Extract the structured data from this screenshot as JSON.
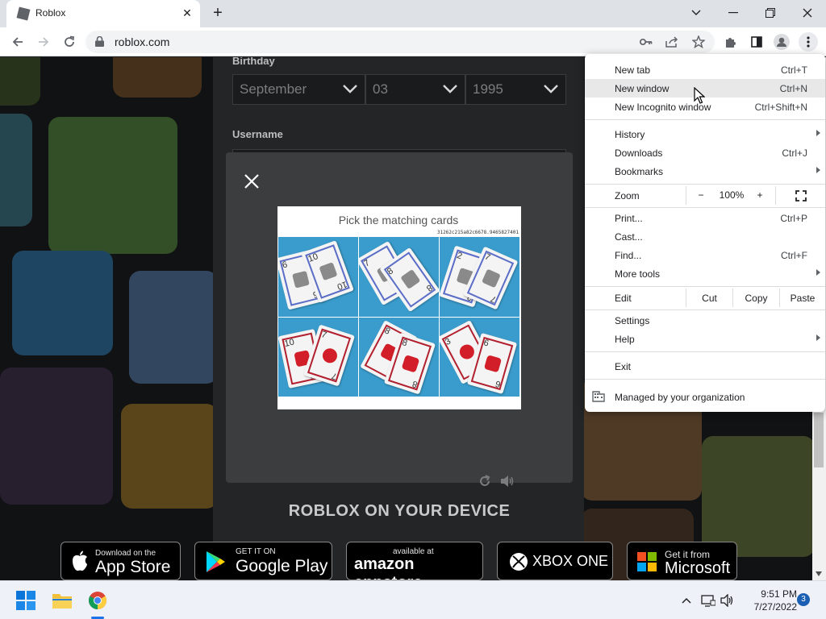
{
  "browser": {
    "tab_title": "Roblox",
    "url": "roblox.com"
  },
  "signup": {
    "birthday_label": "Birthday",
    "month": "September",
    "day": "03",
    "year": "1995",
    "username_label": "Username"
  },
  "captcha": {
    "title": "Pick the matching cards",
    "code": "31262c215a82c6678.9465827401",
    "cells": [
      {
        "cards": [
          {
            "n": "6",
            "sym": "gray"
          },
          {
            "n": "10",
            "sym": "gray"
          }
        ]
      },
      {
        "cards": [
          {
            "n": "7",
            "sym": "gray"
          },
          {
            "n": "8",
            "sym": "gray"
          }
        ]
      },
      {
        "cards": [
          {
            "n": "2",
            "sym": "gray"
          },
          {
            "n": "7",
            "sym": "gray"
          }
        ]
      },
      {
        "cards": [
          {
            "n": "10",
            "sym": "red"
          },
          {
            "n": "7",
            "sym": "redc"
          }
        ]
      },
      {
        "cards": [
          {
            "n": "8",
            "sym": "red"
          },
          {
            "n": "8",
            "sym": "red"
          }
        ]
      },
      {
        "cards": [
          {
            "n": "3",
            "sym": "redc"
          },
          {
            "n": "6",
            "sym": "red"
          }
        ]
      }
    ]
  },
  "device": {
    "heading": "ROBLOX ON YOUR DEVICE",
    "badges": [
      {
        "small": "Download on the",
        "big": "App Store"
      },
      {
        "small": "GET IT ON",
        "big": "Google Play"
      },
      {
        "small": "available at",
        "big": "amazon appstore"
      },
      {
        "small": "",
        "big": "XBOX ONE"
      },
      {
        "small": "Get it from",
        "big": "Microsoft"
      }
    ]
  },
  "menu": {
    "new_tab": {
      "label": "New tab",
      "shortcut": "Ctrl+T"
    },
    "new_window": {
      "label": "New window",
      "shortcut": "Ctrl+N"
    },
    "incognito": {
      "label": "New Incognito window",
      "shortcut": "Ctrl+Shift+N"
    },
    "history": {
      "label": "History"
    },
    "downloads": {
      "label": "Downloads",
      "shortcut": "Ctrl+J"
    },
    "bookmarks": {
      "label": "Bookmarks"
    },
    "zoom": {
      "label": "Zoom",
      "minus": "−",
      "level": "100%",
      "plus": "+"
    },
    "print": {
      "label": "Print...",
      "shortcut": "Ctrl+P"
    },
    "cast": {
      "label": "Cast..."
    },
    "find": {
      "label": "Find...",
      "shortcut": "Ctrl+F"
    },
    "more_tools": {
      "label": "More tools"
    },
    "edit": {
      "label": "Edit",
      "cut": "Cut",
      "copy": "Copy",
      "paste": "Paste"
    },
    "settings": {
      "label": "Settings"
    },
    "help": {
      "label": "Help"
    },
    "exit": {
      "label": "Exit"
    },
    "managed": {
      "label": "Managed by your organization"
    }
  },
  "taskbar": {
    "time": "9:51 PM",
    "date": "7/27/2022",
    "notifications": "3"
  },
  "colors": {
    "accent": "#1a73e8",
    "captcha_bg": "#3a9ccc",
    "card_blue": "#5b6dc7",
    "card_red": "#b2202f"
  }
}
